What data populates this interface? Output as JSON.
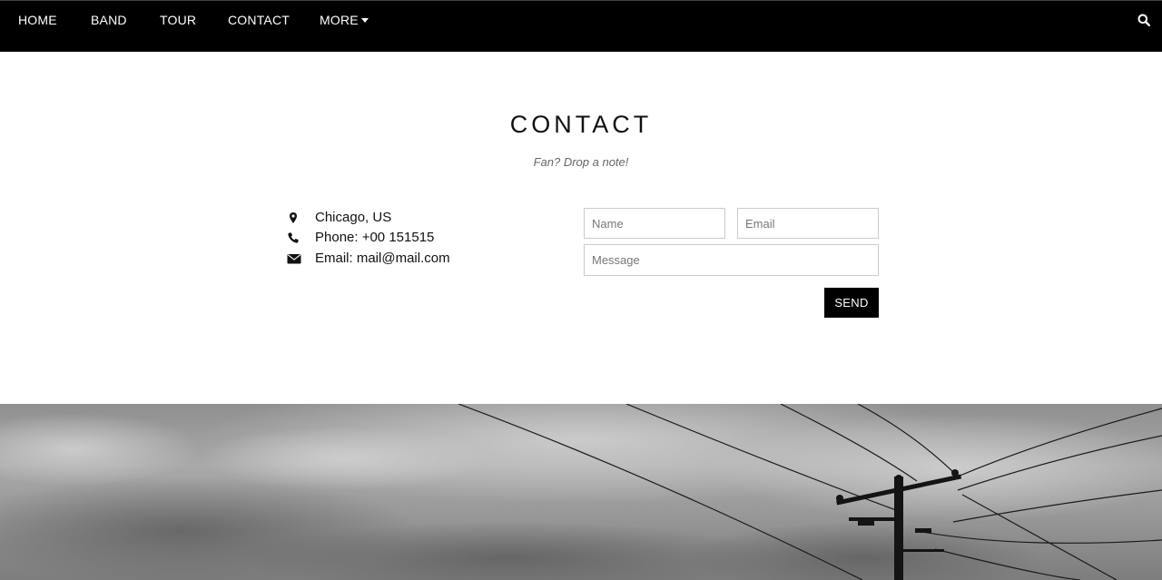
{
  "nav": {
    "items": [
      {
        "label": "HOME"
      },
      {
        "label": "BAND"
      },
      {
        "label": "TOUR"
      },
      {
        "label": "CONTACT"
      },
      {
        "label": "MORE"
      }
    ],
    "more_icon": "caret-down-icon",
    "search_icon": "search-icon"
  },
  "contact": {
    "title": "CONTACT",
    "subtitle": "Fan? Drop a note!",
    "info": {
      "location": {
        "icon": "map-marker-icon",
        "text": "Chicago, US"
      },
      "phone": {
        "icon": "phone-icon",
        "text": "Phone: +00 151515"
      },
      "email": {
        "icon": "envelope-icon",
        "text": "Email: mail@mail.com"
      }
    },
    "form": {
      "name_placeholder": "Name",
      "email_placeholder": "Email",
      "message_placeholder": "Message",
      "send_label": "SEND"
    }
  },
  "hero": {
    "description_icon": "sky-power-lines-photo"
  },
  "colors": {
    "navbar_bg": "#000000",
    "button_bg": "#000000",
    "page_bg": "#ffffff"
  }
}
